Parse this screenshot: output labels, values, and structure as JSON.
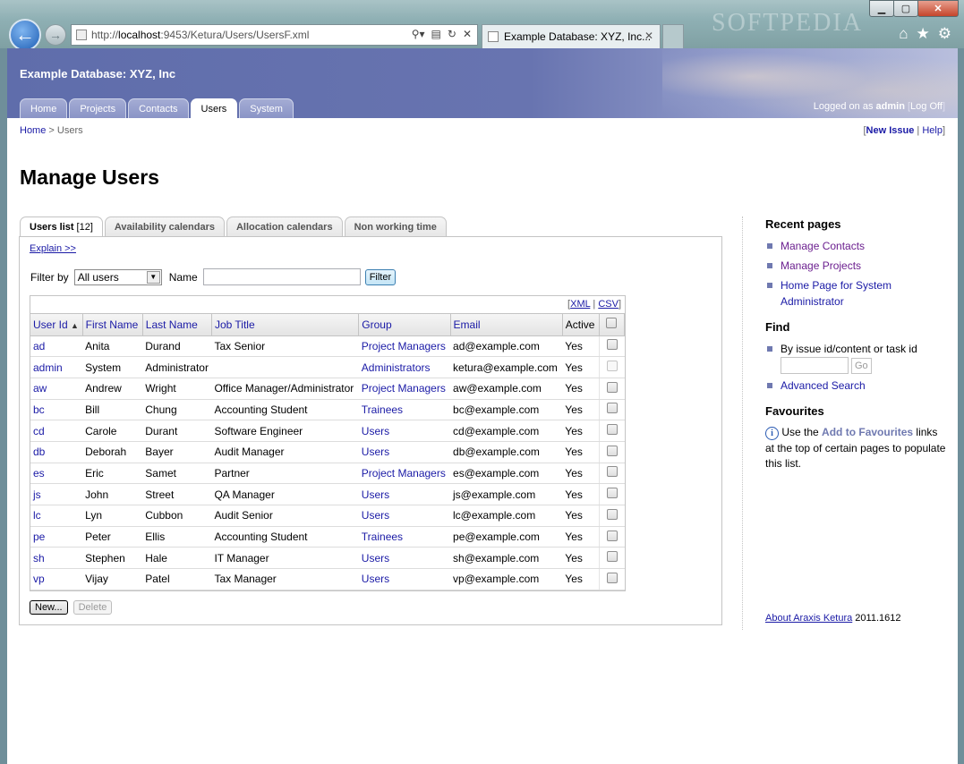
{
  "browser": {
    "url_prefix": "http://",
    "url_host": "localhost",
    "url_rest": ":9453/Ketura/Users/UsersF.xml",
    "tab_title": "Example Database: XYZ, Inc...",
    "watermark": "SOFTPEDIA"
  },
  "header": {
    "site_title": "Example Database: XYZ, Inc",
    "tabs": [
      {
        "label": "Home"
      },
      {
        "label": "Projects"
      },
      {
        "label": "Contacts"
      },
      {
        "label": "Users"
      },
      {
        "label": "System"
      }
    ],
    "logged_prefix": "Logged on as",
    "logged_user": "admin",
    "logoff_label": "Log Off"
  },
  "breadcrumb": {
    "home": "Home",
    "sep": ">",
    "current": "Users"
  },
  "toplinks": {
    "new_issue": "New Issue",
    "help": "Help"
  },
  "page_title": "Manage Users",
  "subtabs": {
    "users_list": "Users list",
    "users_count": "[12]",
    "availability": "Availability calendars",
    "allocation": "Allocation calendars",
    "non_working": "Non working time"
  },
  "explain": "Explain >>",
  "filter": {
    "label": "Filter by",
    "selected": "All users",
    "name_label": "Name",
    "name_value": "",
    "button": "Filter"
  },
  "grid": {
    "xml": "XML",
    "csv": "CSV",
    "columns": [
      "User Id",
      "First Name",
      "Last Name",
      "Job Title",
      "Group",
      "Email",
      "Active"
    ],
    "rows": [
      {
        "id": "ad",
        "first": "Anita",
        "last": "Durand",
        "job": "Tax Senior",
        "group": "Project Managers",
        "email": "ad@example.com",
        "active": "Yes"
      },
      {
        "id": "admin",
        "first": "System",
        "last": "Administrator",
        "job": "",
        "group": "Administrators",
        "email": "ketura@example.com",
        "active": "Yes"
      },
      {
        "id": "aw",
        "first": "Andrew",
        "last": "Wright",
        "job": "Office Manager/Administrator",
        "group": "Project Managers",
        "email": "aw@example.com",
        "active": "Yes"
      },
      {
        "id": "bc",
        "first": "Bill",
        "last": "Chung",
        "job": "Accounting Student",
        "group": "Trainees",
        "email": "bc@example.com",
        "active": "Yes"
      },
      {
        "id": "cd",
        "first": "Carole",
        "last": "Durant",
        "job": "Software Engineer",
        "group": "Users",
        "email": "cd@example.com",
        "active": "Yes"
      },
      {
        "id": "db",
        "first": "Deborah",
        "last": "Bayer",
        "job": "Audit Manager",
        "group": "Users",
        "email": "db@example.com",
        "active": "Yes"
      },
      {
        "id": "es",
        "first": "Eric",
        "last": "Samet",
        "job": "Partner",
        "group": "Project Managers",
        "email": "es@example.com",
        "active": "Yes"
      },
      {
        "id": "js",
        "first": "John",
        "last": "Street",
        "job": "QA Manager",
        "group": "Users",
        "email": "js@example.com",
        "active": "Yes"
      },
      {
        "id": "lc",
        "first": "Lyn",
        "last": "Cubbon",
        "job": "Audit Senior",
        "group": "Users",
        "email": "lc@example.com",
        "active": "Yes"
      },
      {
        "id": "pe",
        "first": "Peter",
        "last": "Ellis",
        "job": "Accounting Student",
        "group": "Trainees",
        "email": "pe@example.com",
        "active": "Yes"
      },
      {
        "id": "sh",
        "first": "Stephen",
        "last": "Hale",
        "job": "IT Manager",
        "group": "Users",
        "email": "sh@example.com",
        "active": "Yes"
      },
      {
        "id": "vp",
        "first": "Vijay",
        "last": "Patel",
        "job": "Tax Manager",
        "group": "Users",
        "email": "vp@example.com",
        "active": "Yes"
      }
    ],
    "new_button": "New...",
    "delete_button": "Delete"
  },
  "sidebar": {
    "recent_title": "Recent pages",
    "recent": [
      "Manage Contacts",
      "Manage Projects",
      "Home Page for System Administrator"
    ],
    "find_title": "Find",
    "find_label": "By issue id/content or task id",
    "go_button": "Go",
    "advanced_search": "Advanced Search",
    "fav_title": "Favourites",
    "fav_text_1": "Use the",
    "fav_highlight": "Add to Favourites",
    "fav_text_2": "links at the top of certain pages to populate this list."
  },
  "about": {
    "link": "About Araxis Ketura",
    "version": "2011.1612"
  }
}
